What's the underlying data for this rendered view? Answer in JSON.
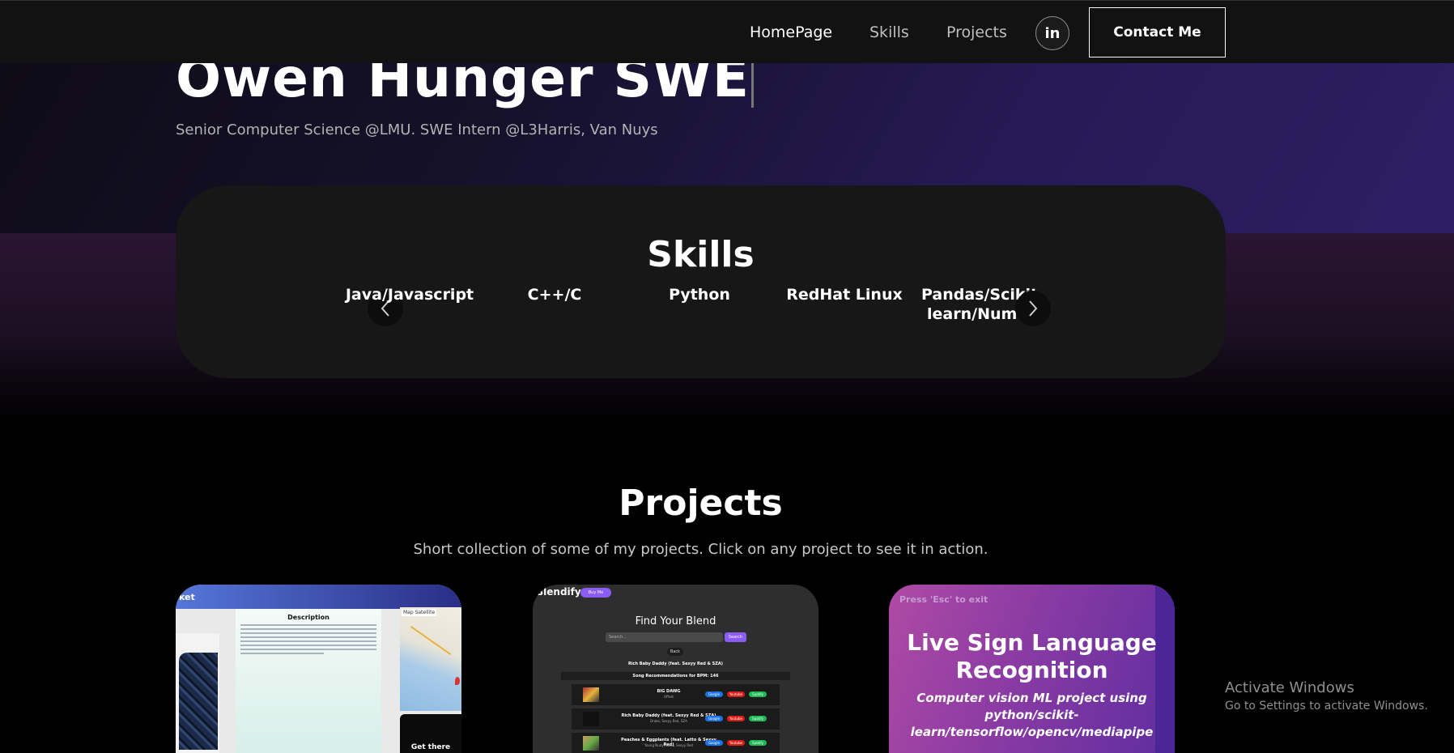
{
  "nav": {
    "links": [
      "HomePage",
      "Skills",
      "Projects"
    ],
    "social_icon": "linkedin-icon",
    "social_label": "in",
    "contact_label": "Contact Me"
  },
  "hero": {
    "title": "Owen Hunger SWE",
    "subtitle": "Senior Computer Science @LMU. SWE Intern @L3Harris, Van Nuys"
  },
  "skills": {
    "title": "Skills",
    "items": [
      "Java/Javascript",
      "C++/C",
      "Python",
      "RedHat Linux",
      "Pandas/Scikit-learn/NumPy"
    ],
    "prev_icon": "chevron-left-icon",
    "next_icon": "chevron-right-icon"
  },
  "projects": {
    "title": "Projects",
    "description": "Short collection of some of my projects. Click on any project to see it in action.",
    "cards": [
      {
        "header": "ket",
        "desc_title": "Description",
        "map_tabs": "Map  Satellite",
        "cta": "Get there"
      },
      {
        "brand": "Blendify",
        "pill": "Buy Me",
        "heading": "Find Your Blend",
        "search_placeholder": "Search...",
        "search_button": "Search",
        "back": "Back",
        "current_song": "Rich Baby Daddy (feat. Sexyy Red & SZA)",
        "recs_label": "Song Recommendations for BPM: 146",
        "tracks": [
          {
            "title": "BIG DAWG",
            "artist": "Offset"
          },
          {
            "title": "Rich Baby Daddy (feat. Sexyy Red & SZA)",
            "artist": "Drake, Sexyy Red, SZA"
          },
          {
            "title": "Peaches & Eggplants (feat. Latto & Sexyy Red)",
            "artist": "Young Nudy, Latto, Sexyy Red"
          }
        ],
        "buttons": [
          "Google",
          "Youtube",
          "Spotify"
        ]
      },
      {
        "esc_hint": "Press 'Esc' to exit",
        "title": "Live Sign Language Recognition",
        "description": "Computer vision ML project using python/scikit-learn/tensorflow/opencv/mediapipe"
      }
    ]
  },
  "watermark": {
    "title": "Activate Windows",
    "subtitle": "Go to Settings to activate Windows."
  }
}
